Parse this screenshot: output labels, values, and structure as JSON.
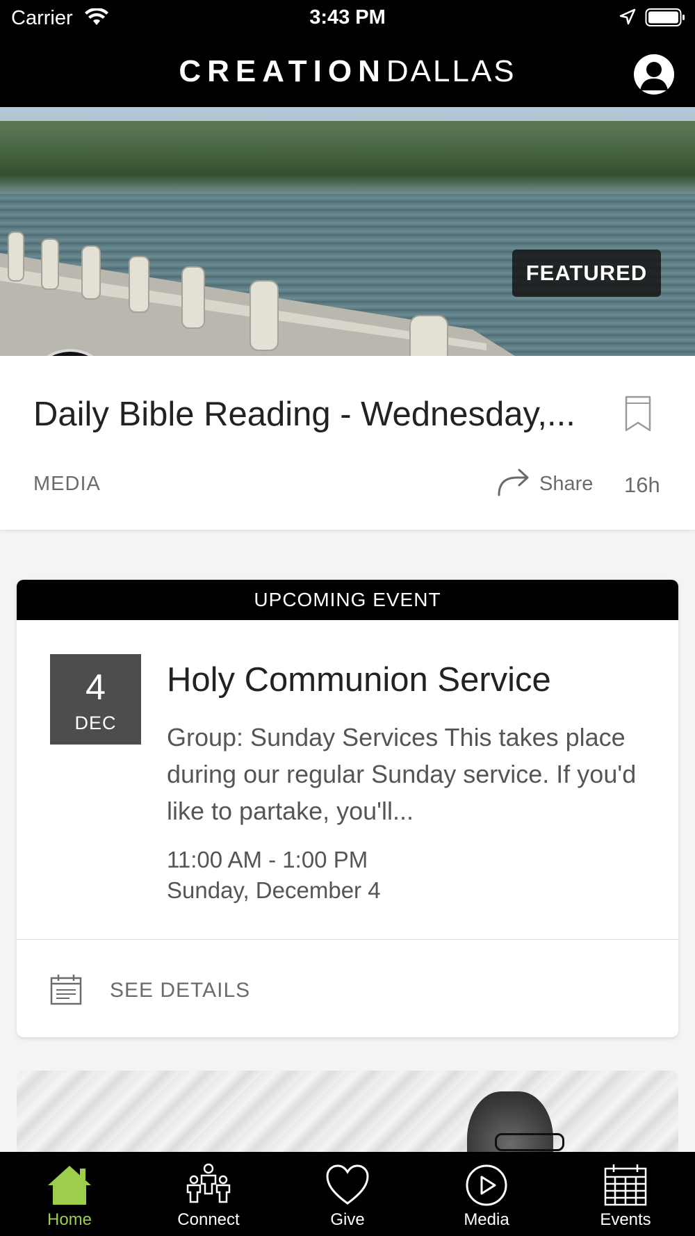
{
  "status_bar": {
    "carrier": "Carrier",
    "time": "3:43 PM",
    "icons": [
      "wifi-icon",
      "location-arrow-icon",
      "battery-icon"
    ]
  },
  "header": {
    "brand_bold": "CREATION",
    "brand_light": "DALLAS",
    "profile_icon": "user-profile-icon"
  },
  "featured": {
    "badge": "FEATURED",
    "media_icon": "headphones-icon",
    "title": "Daily Bible Reading - Wednesday,...",
    "type": "MEDIA",
    "share_label": "Share",
    "age": "16h",
    "bookmark_icon": "bookmark-icon",
    "share_icon": "share-arrow-icon"
  },
  "event": {
    "bar_label": "UPCOMING EVENT",
    "date_day": "4",
    "date_month": "DEC",
    "title": "Holy Communion Service",
    "description": "Group: Sunday Services This takes place during our regular Sunday service. If you'd like to partake, you'll...",
    "time": "11:00 AM - 1:00 PM",
    "date": "Sunday, December 4",
    "details_label": "SEE DETAILS",
    "details_icon": "calendar-details-icon"
  },
  "tabs": [
    {
      "label": "Home",
      "icon": "home-icon",
      "active": true
    },
    {
      "label": "Connect",
      "icon": "people-icon",
      "active": false
    },
    {
      "label": "Give",
      "icon": "heart-icon",
      "active": false
    },
    {
      "label": "Media",
      "icon": "play-circle-icon",
      "active": false
    },
    {
      "label": "Events",
      "icon": "calendar-icon",
      "active": false
    }
  ],
  "colors": {
    "accent_active_tab": "#9ccd4b",
    "header_background": "#000000",
    "date_box": "#4d4d4d",
    "muted_text": "#6b6b6b"
  }
}
